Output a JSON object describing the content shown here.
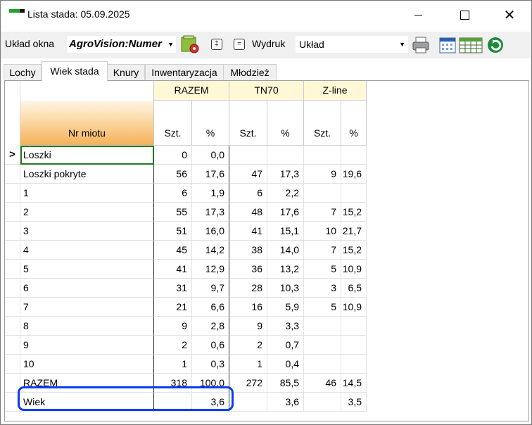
{
  "window": {
    "title": "Lista stada: 05.09.2025"
  },
  "toolbar": {
    "layout_label": "Układ okna",
    "layout_value": "AgroVision:Numer",
    "print_label": "Wydruk",
    "print_value": "Układ",
    "icons": [
      "settings-gear-icon",
      "expand-icon",
      "collapse-icon",
      "printer-icon",
      "calendar-icon",
      "table-grid-icon",
      "refresh-icon"
    ]
  },
  "tabs": [
    {
      "label": "Lochy"
    },
    {
      "label": "Wiek stada",
      "active": true
    },
    {
      "label": "Knury"
    },
    {
      "label": "Inwentaryzacja"
    },
    {
      "label": "Młodzież"
    }
  ],
  "grid": {
    "row_header": "Nr miotu",
    "groups": [
      "RAZEM",
      "TN70",
      "Z-line"
    ],
    "sub_headers": [
      "Szt.",
      "%",
      "Szt.",
      "%",
      "Szt.",
      "%"
    ],
    "current_marker": ">",
    "rows": [
      {
        "label": "Loszki",
        "values": [
          "0",
          "0,0",
          "",
          "",
          "",
          ""
        ]
      },
      {
        "label": "Loszki pokryte",
        "values": [
          "56",
          "17,6",
          "47",
          "17,3",
          "9",
          "19,6"
        ]
      },
      {
        "label": "1",
        "values": [
          "6",
          "1,9",
          "6",
          "2,2",
          "",
          ""
        ]
      },
      {
        "label": "2",
        "values": [
          "55",
          "17,3",
          "48",
          "17,6",
          "7",
          "15,2"
        ]
      },
      {
        "label": "3",
        "values": [
          "51",
          "16,0",
          "41",
          "15,1",
          "10",
          "21,7"
        ]
      },
      {
        "label": "4",
        "values": [
          "45",
          "14,2",
          "38",
          "14,0",
          "7",
          "15,2"
        ]
      },
      {
        "label": "5",
        "values": [
          "41",
          "12,9",
          "36",
          "13,2",
          "5",
          "10,9"
        ]
      },
      {
        "label": "6",
        "values": [
          "31",
          "9,7",
          "28",
          "10,3",
          "3",
          "6,5"
        ]
      },
      {
        "label": "7",
        "values": [
          "21",
          "6,6",
          "16",
          "5,9",
          "5",
          "10,9"
        ]
      },
      {
        "label": "8",
        "values": [
          "9",
          "2,8",
          "9",
          "3,3",
          "",
          ""
        ]
      },
      {
        "label": "9",
        "values": [
          "2",
          "0,6",
          "2",
          "0,7",
          "",
          ""
        ]
      },
      {
        "label": "10",
        "values": [
          "1",
          "0,3",
          "1",
          "0,4",
          "",
          ""
        ]
      },
      {
        "label": "RAZEM",
        "values": [
          "318",
          "100,0",
          "272",
          "85,5",
          "46",
          "14,5"
        ]
      },
      {
        "label": "Wiek",
        "values": [
          "",
          "3,6",
          "",
          "3,6",
          "",
          "3,5"
        ]
      }
    ]
  },
  "colors": {
    "highlight": "#0a3df0",
    "group_header_bg": "#fff8d6",
    "current_cell_border": "#217a21"
  }
}
